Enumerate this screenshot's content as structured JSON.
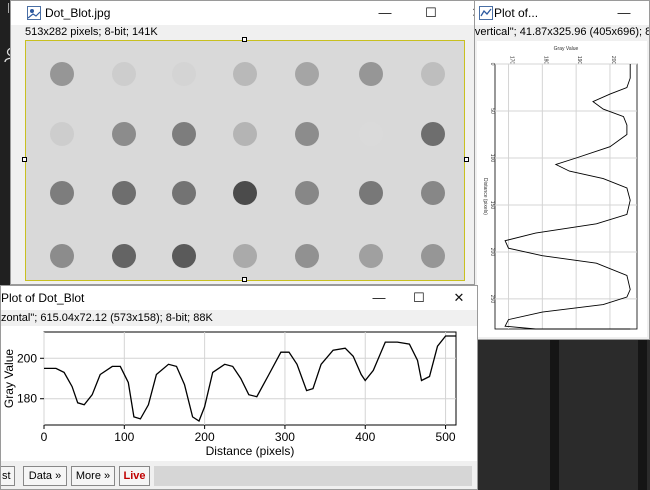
{
  "image_window": {
    "title": "Dot_Blot.jpg",
    "info": "513x282 pixels; 8-bit; 141K",
    "dots": [
      {
        "row": 1,
        "col": 1,
        "gray": 150
      },
      {
        "row": 1,
        "col": 2,
        "gray": 205
      },
      {
        "row": 1,
        "col": 3,
        "gray": 212
      },
      {
        "row": 1,
        "col": 4,
        "gray": 185
      },
      {
        "row": 1,
        "col": 5,
        "gray": 165
      },
      {
        "row": 1,
        "col": 6,
        "gray": 150
      },
      {
        "row": 1,
        "col": 7,
        "gray": 190
      },
      {
        "row": 2,
        "col": 1,
        "gray": 205
      },
      {
        "row": 2,
        "col": 2,
        "gray": 140
      },
      {
        "row": 2,
        "col": 3,
        "gray": 125
      },
      {
        "row": 2,
        "col": 4,
        "gray": 180
      },
      {
        "row": 2,
        "col": 5,
        "gray": 140
      },
      {
        "row": 2,
        "col": 6,
        "gray": 218
      },
      {
        "row": 2,
        "col": 7,
        "gray": 110
      },
      {
        "row": 3,
        "col": 1,
        "gray": 125
      },
      {
        "row": 3,
        "col": 2,
        "gray": 110
      },
      {
        "row": 3,
        "col": 3,
        "gray": 115
      },
      {
        "row": 3,
        "col": 4,
        "gray": 75
      },
      {
        "row": 3,
        "col": 5,
        "gray": 135
      },
      {
        "row": 3,
        "col": 6,
        "gray": 120
      },
      {
        "row": 3,
        "col": 7,
        "gray": 135
      },
      {
        "row": 4,
        "col": 1,
        "gray": 140
      },
      {
        "row": 4,
        "col": 2,
        "gray": 100
      },
      {
        "row": 4,
        "col": 3,
        "gray": 90
      },
      {
        "row": 4,
        "col": 4,
        "gray": 170
      },
      {
        "row": 4,
        "col": 5,
        "gray": 145
      },
      {
        "row": 4,
        "col": 6,
        "gray": 160
      },
      {
        "row": 4,
        "col": 7,
        "gray": 150
      }
    ]
  },
  "vertical_plot_window": {
    "title": "Plot of...",
    "info": "\"vertical\"; 41.87x325.96  (405x696); 8-",
    "x_label": "Gray Value",
    "y_label": "Distance (pixels)",
    "x_ticks": [
      "170",
      "180",
      "190",
      "200"
    ],
    "y_ticks": [
      "0",
      "50",
      "100",
      "150",
      "200",
      "250"
    ]
  },
  "horizontal_plot_window": {
    "title": "Plot of Dot_Blot",
    "info": "zontal\"; 615.04x72.12  (573x158); 8-bit; 88K",
    "buttons": {
      "list": "st",
      "data": "Data »",
      "more": "More »",
      "live": "Live"
    }
  },
  "chart_data": [
    {
      "type": "line",
      "title": "",
      "xlabel": "Distance (pixels)",
      "ylabel": "Gray Value",
      "xlim": [
        0,
        513
      ],
      "ylim": [
        167,
        213
      ],
      "x_ticks": [
        "0",
        "100",
        "200",
        "300",
        "400",
        "500"
      ],
      "y_ticks": [
        "180",
        "200"
      ],
      "grid": true,
      "series": [
        {
          "x": [
            0,
            15,
            25,
            35,
            42,
            50,
            60,
            70,
            85,
            95,
            105,
            112,
            120,
            130,
            140,
            155,
            165,
            175,
            185,
            193,
            200,
            210,
            225,
            235,
            245,
            255,
            265,
            280,
            295,
            305,
            315,
            327,
            335,
            345,
            360,
            375,
            385,
            395,
            400,
            410,
            425,
            440,
            455,
            465,
            470,
            480,
            490,
            500,
            513
          ],
          "y": [
            195,
            195,
            193,
            186,
            178,
            177,
            182,
            192,
            196,
            196,
            188,
            171,
            170,
            177,
            192,
            197,
            196,
            187,
            171,
            169,
            176,
            193,
            197,
            196,
            190,
            182,
            181,
            192,
            203,
            203,
            197,
            184,
            185,
            197,
            204,
            205,
            201,
            192,
            189,
            194,
            208,
            208,
            207,
            199,
            189,
            191,
            206,
            211,
            211
          ]
        }
      ]
    },
    {
      "type": "line",
      "title": "",
      "xlabel": "Gray Value",
      "ylabel": "Distance (pixels)",
      "xlim": [
        166,
        208
      ],
      "ylim": [
        0,
        282
      ],
      "x_ticks": [
        "170",
        "180",
        "190",
        "200"
      ],
      "y_ticks": [
        "0",
        "50",
        "100",
        "150",
        "200",
        "250"
      ],
      "grid": true,
      "series": [
        {
          "x": [
            206,
            206,
            205,
            200,
            195,
            198,
            204,
            205,
            205,
            200,
            190,
            184,
            188,
            198,
            205,
            206,
            205,
            196,
            178,
            169,
            170,
            180,
            196,
            205,
            206,
            205,
            198,
            180,
            170,
            169,
            178,
            195,
            204,
            206,
            206
          ],
          "y": [
            0,
            15,
            25,
            32,
            40,
            48,
            56,
            65,
            75,
            88,
            100,
            107,
            114,
            122,
            132,
            145,
            160,
            170,
            180,
            188,
            196,
            204,
            212,
            225,
            240,
            248,
            256,
            264,
            272,
            279,
            282,
            282,
            282,
            282,
            282
          ]
        }
      ]
    }
  ]
}
